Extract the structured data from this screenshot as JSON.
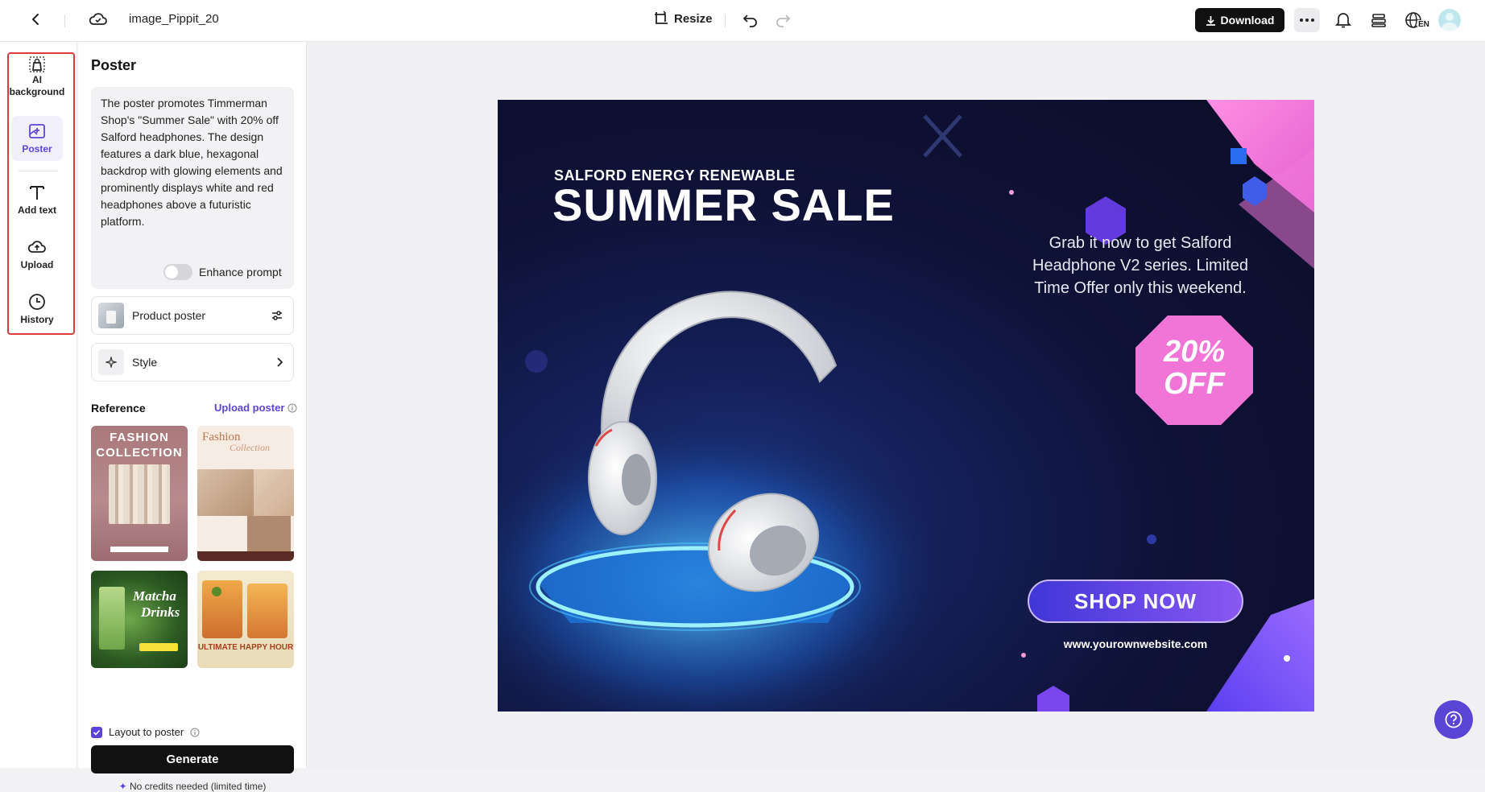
{
  "topbar": {
    "file_name": "image_Pippit_20",
    "resize_label": "Resize",
    "download_label": "Download",
    "lang_badge": "EN"
  },
  "rail": {
    "items": [
      {
        "label": "AI background",
        "icon": "bag-icon"
      },
      {
        "label": "Poster",
        "icon": "poster-icon",
        "active": true
      },
      {
        "label": "Add text",
        "icon": "text-icon"
      },
      {
        "label": "Upload",
        "icon": "cloud-upload-icon"
      },
      {
        "label": "History",
        "icon": "clock-icon"
      }
    ]
  },
  "panel": {
    "title": "Poster",
    "prompt": "The poster promotes Timmerman Shop's \"Summer Sale\" with 20% off Salford headphones. The design features a dark blue, hexagonal backdrop with glowing elements and prominently displays white and red headphones above a futuristic platform.",
    "enhance_label": "Enhance prompt",
    "enhance_on": false,
    "product_label": "Product poster",
    "style_label": "Style",
    "reference_title": "Reference",
    "upload_poster_label": "Upload poster",
    "references": [
      {
        "line1": "FASHION",
        "line2": "COLLECTION"
      },
      {
        "line1": "Fashion",
        "line2": "Collection"
      },
      {
        "line1": "Matcha",
        "line2": "Drinks"
      },
      {
        "line1": "ULTIMATE HAPPY HOUR",
        "line2": ""
      }
    ],
    "layout_label": "Layout to poster",
    "layout_checked": true,
    "generate_label": "Generate",
    "credits_note": "No credits needed (limited time)"
  },
  "poster": {
    "brand": "SALFORD ENERGY RENEWABLE",
    "headline": "SUMMER SALE",
    "tagline_1": "Grab it now to get Salford",
    "tagline_2": "Headphone V2 series. Limited",
    "tagline_3": "Time Offer only this weekend.",
    "discount_1": "20%",
    "discount_2": "OFF",
    "cta": "SHOP NOW",
    "website": "www.yourownwebsite.com"
  },
  "colors": {
    "accent": "#5b45d6",
    "highlight_border": "#e23a3a",
    "poster_bg": "#0f1237",
    "poster_pink": "#f472d8",
    "poster_cyan": "#38bdf8"
  }
}
